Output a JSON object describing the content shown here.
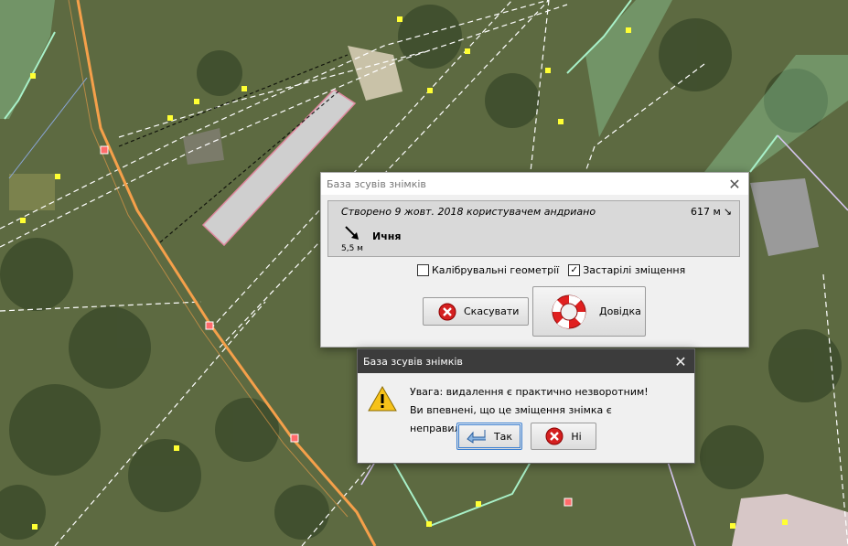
{
  "shift_dialog": {
    "title": "База зсувів знімків",
    "entry": {
      "created": "Створено 9 жовт. 2018 користувачем андриано",
      "distance": "617 м",
      "name": "Ичня",
      "size": "5,5 м"
    },
    "checkbox_calibration": {
      "label": "Калібрувальні геометрії",
      "checked": false
    },
    "checkbox_obsolete": {
      "label": "Застарілі зміщення",
      "checked": true
    },
    "cancel_label": "Скасувати",
    "help_label": "Довідка"
  },
  "confirm_dialog": {
    "title": "База зсувів знімків",
    "message_line1": "Увага: видалення є практично незворотним!",
    "message_line2": "Ви впевнені, що це зміщення знімка є неправильним?",
    "yes_label": "Так",
    "no_label": "Ні"
  },
  "colors": {
    "road_primary": "#f5a04a",
    "railway": "#ffffff",
    "landuse_green": "#9be3b0",
    "vertex_marker": "#ffff33"
  }
}
